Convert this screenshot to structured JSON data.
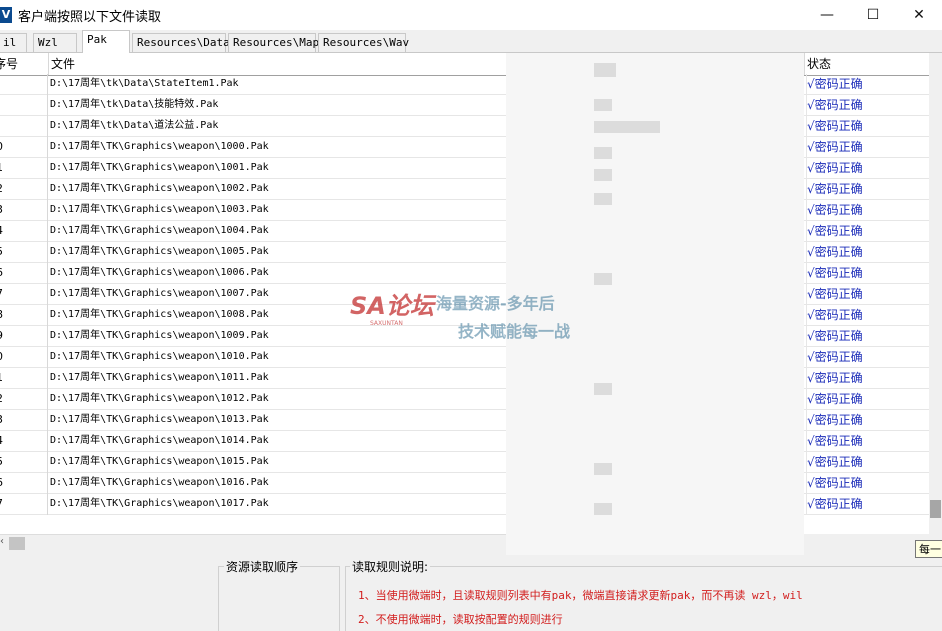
{
  "window": {
    "title": "客户端按照以下文件读取",
    "icon_letter": "V",
    "controls": {
      "minimize": "—",
      "maximize": "☐",
      "close": "✕"
    }
  },
  "tabs": [
    {
      "label": "il",
      "active": false
    },
    {
      "label": "Wzl",
      "active": false
    },
    {
      "label": "Pak",
      "active": true
    },
    {
      "label": "Resources\\Data",
      "active": false
    },
    {
      "label": "Resources\\Map",
      "active": false
    },
    {
      "label": "Resources\\Wav",
      "active": false
    }
  ],
  "grid": {
    "headers": {
      "no": "序号",
      "file": "文件",
      "status": "状态"
    },
    "rows": [
      {
        "no": "",
        "file": "D:\\17周年\\tk\\Data\\StateItem1.Pak",
        "status": "√密码正确"
      },
      {
        "no": "",
        "file": "D:\\17周年\\tk\\Data\\技能特效.Pak",
        "status": "√密码正确"
      },
      {
        "no": "",
        "file": "D:\\17周年\\tk\\Data\\道法公益.Pak",
        "status": "√密码正确"
      },
      {
        "no": "0",
        "file": "D:\\17周年\\TK\\Graphics\\weapon\\1000.Pak",
        "status": "√密码正确"
      },
      {
        "no": "1",
        "file": "D:\\17周年\\TK\\Graphics\\weapon\\1001.Pak",
        "status": "√密码正确"
      },
      {
        "no": "2",
        "file": "D:\\17周年\\TK\\Graphics\\weapon\\1002.Pak",
        "status": "√密码正确"
      },
      {
        "no": "3",
        "file": "D:\\17周年\\TK\\Graphics\\weapon\\1003.Pak",
        "status": "√密码正确"
      },
      {
        "no": "4",
        "file": "D:\\17周年\\TK\\Graphics\\weapon\\1004.Pak",
        "status": "√密码正确"
      },
      {
        "no": "5",
        "file": "D:\\17周年\\TK\\Graphics\\weapon\\1005.Pak",
        "status": "√密码正确"
      },
      {
        "no": "6",
        "file": "D:\\17周年\\TK\\Graphics\\weapon\\1006.Pak",
        "status": "√密码正确"
      },
      {
        "no": "7",
        "file": "D:\\17周年\\TK\\Graphics\\weapon\\1007.Pak",
        "status": "√密码正确"
      },
      {
        "no": "8",
        "file": "D:\\17周年\\TK\\Graphics\\weapon\\1008.Pak",
        "status": "√密码正确"
      },
      {
        "no": "9",
        "file": "D:\\17周年\\TK\\Graphics\\weapon\\1009.Pak",
        "status": "√密码正确"
      },
      {
        "no": "0",
        "file": "D:\\17周年\\TK\\Graphics\\weapon\\1010.Pak",
        "status": "√密码正确"
      },
      {
        "no": "1",
        "file": "D:\\17周年\\TK\\Graphics\\weapon\\1011.Pak",
        "status": "√密码正确"
      },
      {
        "no": "2",
        "file": "D:\\17周年\\TK\\Graphics\\weapon\\1012.Pak",
        "status": "√密码正确"
      },
      {
        "no": "3",
        "file": "D:\\17周年\\TK\\Graphics\\weapon\\1013.Pak",
        "status": "√密码正确"
      },
      {
        "no": "4",
        "file": "D:\\17周年\\TK\\Graphics\\weapon\\1014.Pak",
        "status": "√密码正确"
      },
      {
        "no": "5",
        "file": "D:\\17周年\\TK\\Graphics\\weapon\\1015.Pak",
        "status": "√密码正确"
      },
      {
        "no": "6",
        "file": "D:\\17周年\\TK\\Graphics\\weapon\\1016.Pak",
        "status": "√密码正确"
      },
      {
        "no": "7",
        "file": "D:\\17周年\\TK\\Graphics\\weapon\\1017.Pak",
        "status": "√密码正确"
      }
    ]
  },
  "tooltip": {
    "text": "每一"
  },
  "bottom": {
    "order_title": "资源读取顺序",
    "rules_title": "读取规则说明:",
    "rules": [
      "1、当使用微端时，且读取规则列表中有pak，微端直接请求更新pak，而不再读 wzl，wil",
      "2、不使用微端时，读取按配置的规则进行"
    ]
  },
  "watermark": {
    "logo": "SA论坛",
    "sub": "SAXUNTAN",
    "line1": "海量资源-多年后",
    "line2": "技术赋能每一战"
  },
  "colors": {
    "status_text": "#1a2bb8",
    "rule_text": "#d21d1d",
    "selected_tab_bg": "#ffffff"
  }
}
